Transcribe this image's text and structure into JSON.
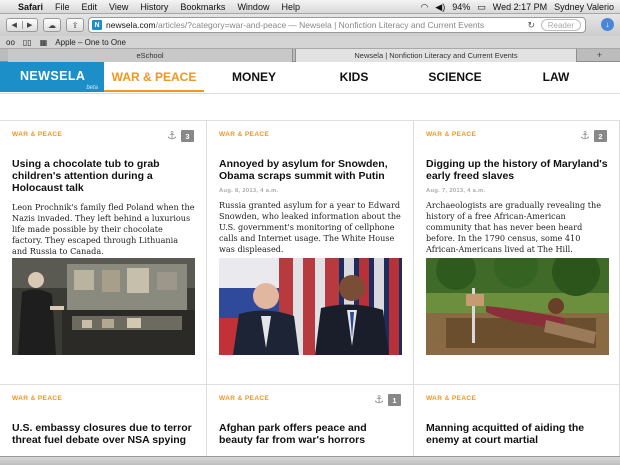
{
  "menubar": {
    "apple": "",
    "items": [
      "Safari",
      "File",
      "Edit",
      "View",
      "History",
      "Bookmarks",
      "Window",
      "Help"
    ],
    "battery": "94%",
    "clock": "Wed 2:17 PM",
    "user": "Sydney Valerio"
  },
  "toolbar": {
    "url_host": "newsela.com",
    "url_path": "/articles/?category=war-and-peace",
    "url_title": "— Newsela | Nonfiction Literacy and Current Events",
    "favicon": "N",
    "reader_label": "Reader"
  },
  "bookmarks": {
    "items": [
      "Apple – One to One"
    ]
  },
  "tabs": [
    {
      "label": "eSchool"
    },
    {
      "label": "Newsela | Nonfiction Literacy and Current Events"
    }
  ],
  "site": {
    "logo": "NEWSELA",
    "beta": "beta",
    "nav": [
      "WAR & PEACE",
      "MONEY",
      "KIDS",
      "SCIENCE",
      "LAW"
    ],
    "active_index": 0
  },
  "articles": [
    {
      "category": "WAR & PEACE",
      "count": "3",
      "title": "Using a chocolate tub to grab children's attention during a Holocaust talk",
      "date": "",
      "summary": "Leon Prochnik's family fled Poland when the Nazis invaded. They left behind a luxurious life made possible by their chocolate factory. They escaped through Lithuania and Russia to Canada."
    },
    {
      "category": "WAR & PEACE",
      "count": "",
      "title": "Annoyed by asylum for Snowden, Obama scraps summit with Putin",
      "date": "Aug. 8, 2013, 4 a.m.",
      "summary": "Russia granted asylum for a year to Edward Snowden, who leaked information about the U.S. government's monitoring of cellphone calls and Internet usage. The White House was displeased."
    },
    {
      "category": "WAR & PEACE",
      "count": "2",
      "title": "Digging up the history of Maryland's early freed slaves",
      "date": "Aug. 7, 2013, 4 a.m.",
      "summary": "Archaeologists are gradually revealing the history of a free African-American community that has never been heard before. In the 1790 census, some 410 African-Americans lived at The Hill."
    },
    {
      "category": "WAR & PEACE",
      "count": "",
      "title": "U.S. embassy closures due to terror threat fuel debate over NSA spying",
      "date": "",
      "summary": ""
    },
    {
      "category": "WAR & PEACE",
      "count": "1",
      "title": "Afghan park offers peace and beauty far from war's horrors",
      "date": "",
      "summary": ""
    },
    {
      "category": "WAR & PEACE",
      "count": "",
      "title": "Manning acquitted of aiding the enemy at court martial",
      "date": "",
      "summary": ""
    }
  ]
}
